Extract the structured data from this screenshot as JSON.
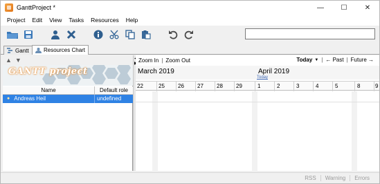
{
  "window": {
    "title": "GanttProject *"
  },
  "window_controls": {
    "minimize": "—",
    "maximize": "☐",
    "close": "✕"
  },
  "menu": [
    {
      "label": "Project"
    },
    {
      "label": "Edit"
    },
    {
      "label": "View"
    },
    {
      "label": "Tasks"
    },
    {
      "label": "Resources"
    },
    {
      "label": "Help"
    }
  ],
  "toolbar": {
    "icons": [
      "open-folder-icon",
      "save-icon",
      "new-resource-icon",
      "delete-icon",
      "properties-icon",
      "cut-icon",
      "copy-icon",
      "paste-icon",
      "undo-icon",
      "redo-icon"
    ],
    "search_value": ""
  },
  "tabs": [
    {
      "label": "Gantt",
      "active": false
    },
    {
      "label": "Resources Chart",
      "active": true
    }
  ],
  "left_panel": {
    "logo_text": "GANTT project",
    "columns": [
      "Name",
      "Default role"
    ],
    "rows": [
      {
        "name": "Andreas Heil",
        "role": "undefined",
        "selected": true
      }
    ]
  },
  "chart": {
    "zoom_in": "Zoom In",
    "zoom_separator": "|",
    "zoom_out": "Zoom Out",
    "today_label": "Today",
    "today_caret": "▼",
    "nav_separator": "|",
    "past_label": "← Past",
    "future_label": "Future →",
    "months": [
      "March 2019",
      "April 2019"
    ],
    "today_marker": "Today",
    "days": [
      "22",
      "25",
      "26",
      "27",
      "28",
      "29",
      "1",
      "2",
      "3",
      "4",
      "5",
      "8",
      "9"
    ]
  },
  "status": [
    "RSS",
    "Warning",
    "Errors"
  ]
}
